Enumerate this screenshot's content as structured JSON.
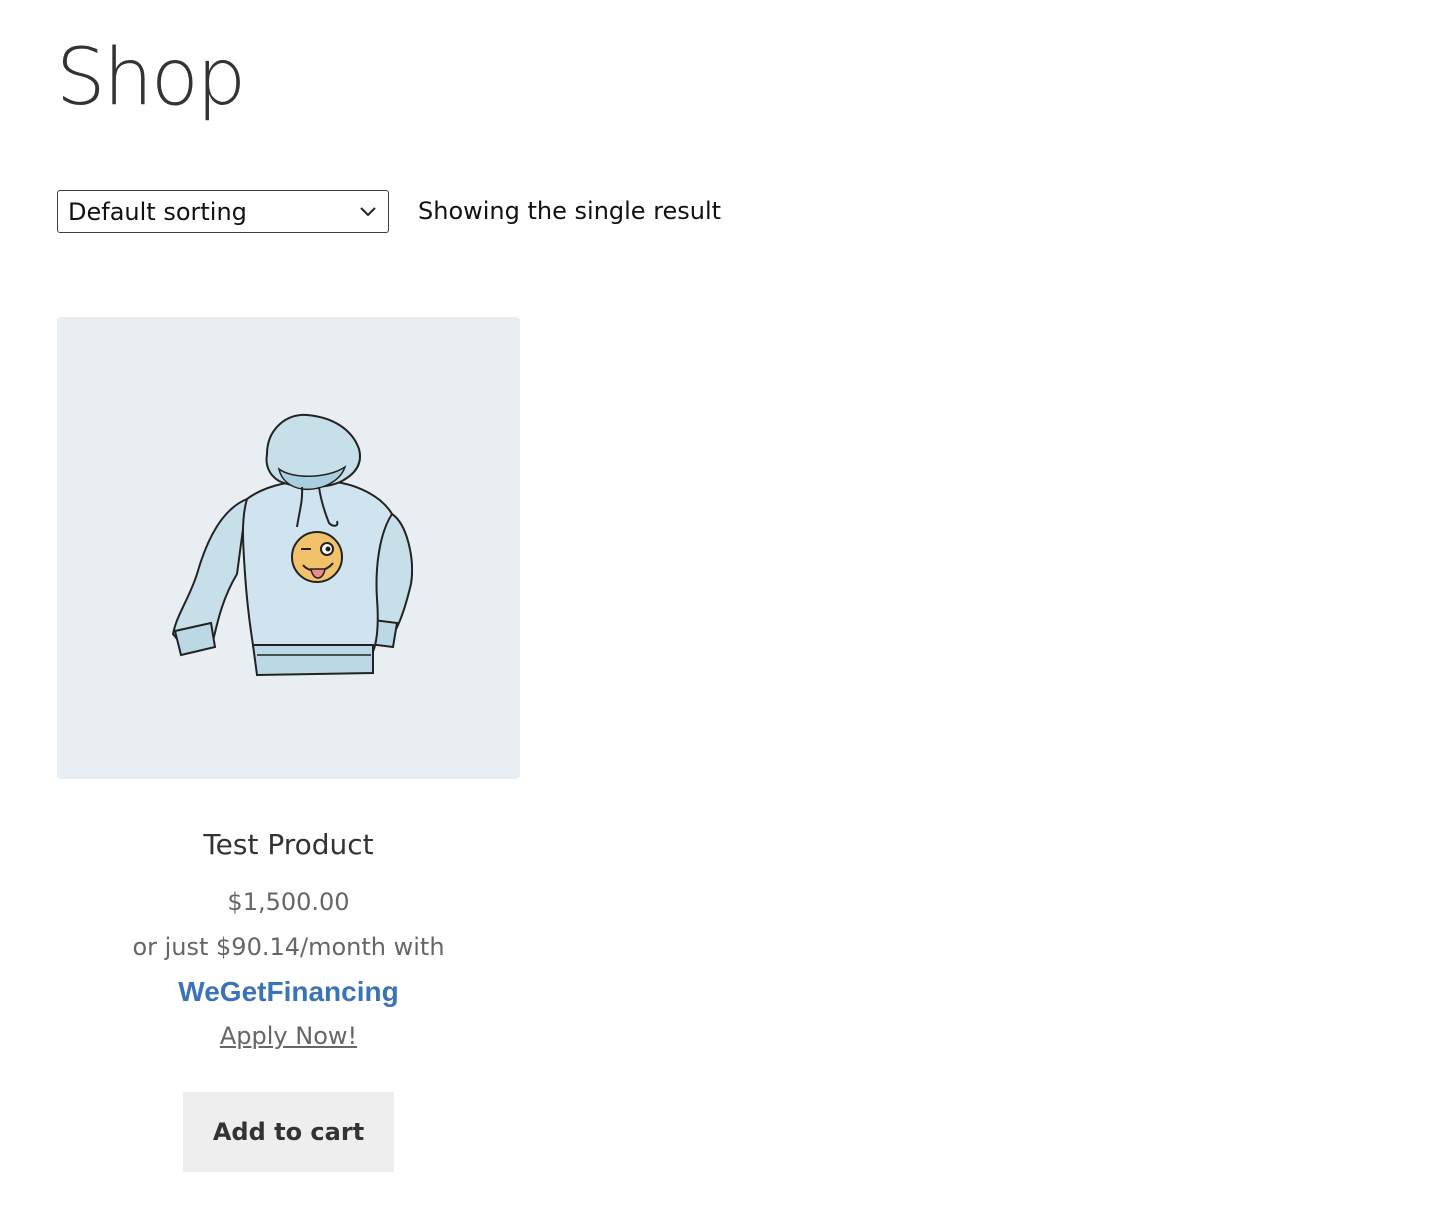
{
  "page": {
    "title": "Shop"
  },
  "toolbar": {
    "sort_selected": "Default sorting",
    "result_count": "Showing the single result"
  },
  "product": {
    "title": "Test Product",
    "price": "$1,500.00",
    "financing_text": "or just $90.14/month with",
    "financing_brand": "WeGetFinancing",
    "apply_link": "Apply Now!",
    "add_to_cart_label": "Add to cart",
    "image_icon": "hoodie-illustration"
  },
  "colors": {
    "image_background": "#e9eef2",
    "financing_brand": "#3b73b9",
    "button_background": "#eeeeee",
    "title_text": "#333333",
    "muted_text": "#666666"
  }
}
